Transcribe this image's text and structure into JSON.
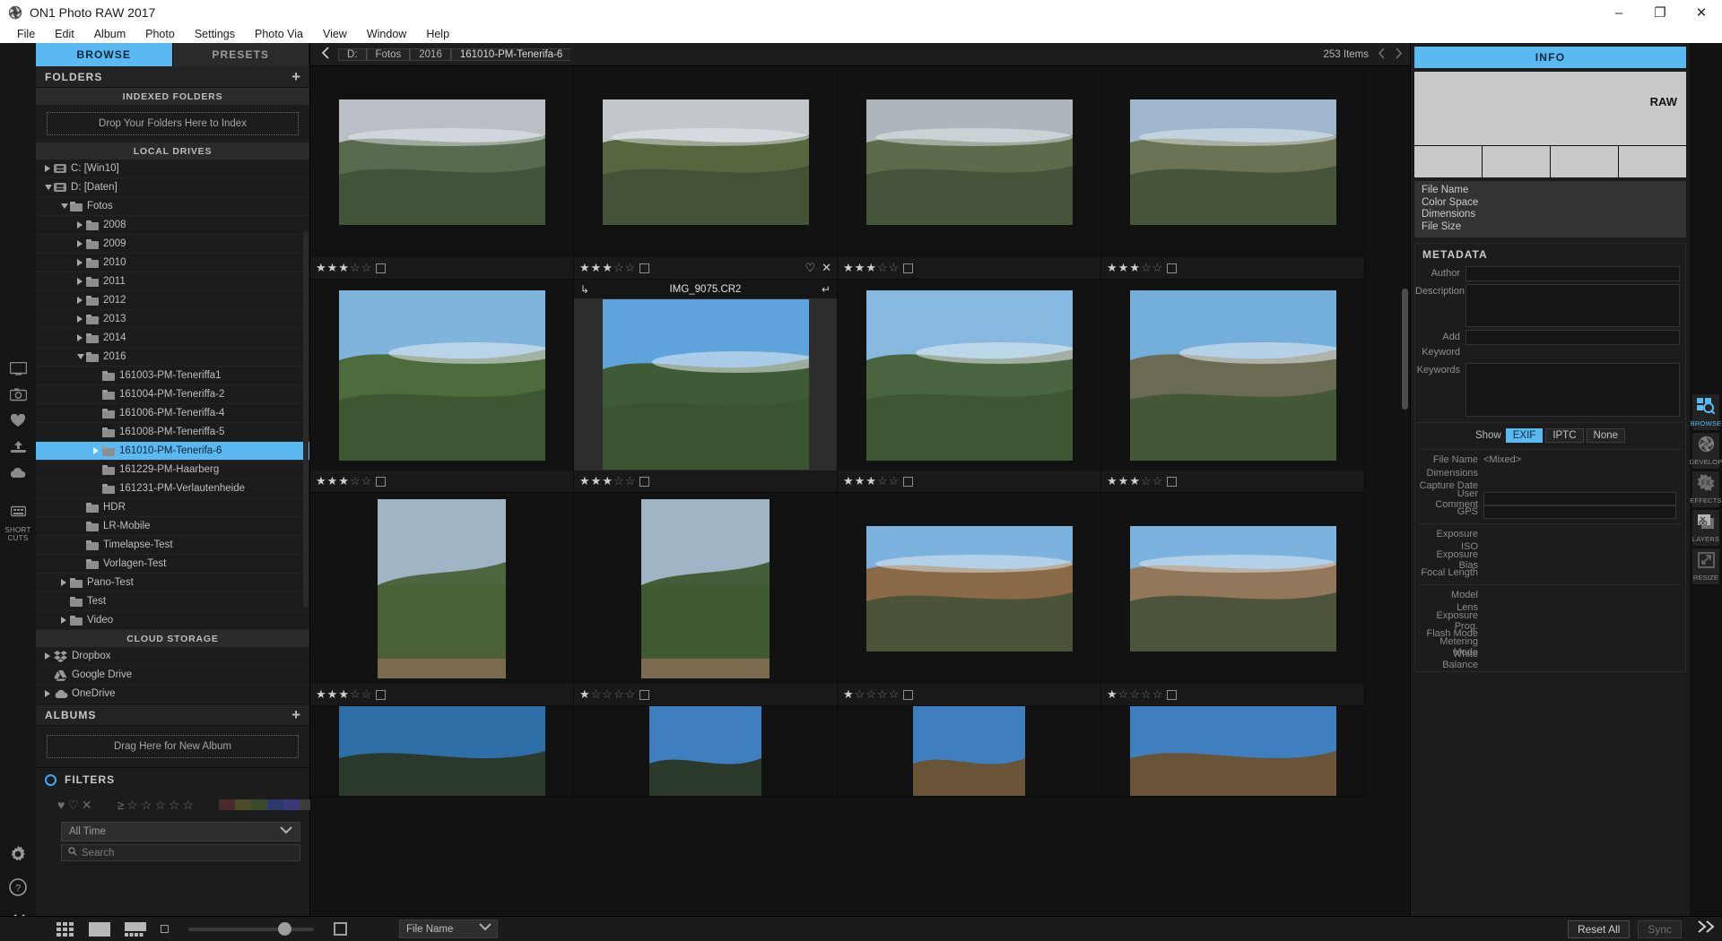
{
  "window": {
    "title": "ON1 Photo RAW 2017",
    "app_icon": "aperture-icon",
    "minimize": "–",
    "maximize": "❐",
    "close": "✕"
  },
  "menubar": [
    "File",
    "Edit",
    "Album",
    "Photo",
    "Settings",
    "Photo Via",
    "View",
    "Window",
    "Help"
  ],
  "left_panel": {
    "tabs": [
      {
        "label": "BROWSE",
        "active": true
      },
      {
        "label": "PRESETS",
        "active": false
      }
    ],
    "folders_title": "FOLDERS",
    "add_label": "+",
    "indexed_header": "INDEXED FOLDERS",
    "drop_label": "Drop Your Folders Here to Index",
    "local_header": "LOCAL DRIVES",
    "tree": [
      {
        "label": "C: [Win10]",
        "indent": 0,
        "arrow": "right",
        "icon": "drive-icon"
      },
      {
        "label": "D: [Daten]",
        "indent": 0,
        "arrow": "down",
        "icon": "drive-icon"
      },
      {
        "label": "Fotos",
        "indent": 1,
        "arrow": "down",
        "icon": "folder-icon"
      },
      {
        "label": "2008",
        "indent": 2,
        "arrow": "right",
        "icon": "folder-icon"
      },
      {
        "label": "2009",
        "indent": 2,
        "arrow": "right",
        "icon": "folder-icon"
      },
      {
        "label": "2010",
        "indent": 2,
        "arrow": "right",
        "icon": "folder-icon"
      },
      {
        "label": "2011",
        "indent": 2,
        "arrow": "right",
        "icon": "folder-icon"
      },
      {
        "label": "2012",
        "indent": 2,
        "arrow": "right",
        "icon": "folder-icon"
      },
      {
        "label": "2013",
        "indent": 2,
        "arrow": "right",
        "icon": "folder-icon"
      },
      {
        "label": "2014",
        "indent": 2,
        "arrow": "right",
        "icon": "folder-icon"
      },
      {
        "label": "2016",
        "indent": 2,
        "arrow": "down",
        "icon": "folder-icon"
      },
      {
        "label": "161003-PM-Teneriffa1",
        "indent": 3,
        "arrow": "none",
        "icon": "folder-icon"
      },
      {
        "label": "161004-PM-Teneriffa-2",
        "indent": 3,
        "arrow": "none",
        "icon": "folder-icon"
      },
      {
        "label": "161006-PM-Teneriffa-4",
        "indent": 3,
        "arrow": "none",
        "icon": "folder-icon"
      },
      {
        "label": "161008-PM-Teneriffa-5",
        "indent": 3,
        "arrow": "none",
        "icon": "folder-icon"
      },
      {
        "label": "161010-PM-Tenerifa-6",
        "indent": 3,
        "arrow": "right",
        "icon": "folder-icon",
        "selected": true
      },
      {
        "label": "161229-PM-Haarberg",
        "indent": 3,
        "arrow": "none",
        "icon": "folder-icon"
      },
      {
        "label": "161231-PM-Verlautenheide",
        "indent": 3,
        "arrow": "none",
        "icon": "folder-icon"
      },
      {
        "label": "HDR",
        "indent": 2,
        "arrow": "none",
        "icon": "folder-icon"
      },
      {
        "label": "LR-Mobile",
        "indent": 2,
        "arrow": "none",
        "icon": "folder-icon"
      },
      {
        "label": "Timelapse-Test",
        "indent": 2,
        "arrow": "none",
        "icon": "folder-icon"
      },
      {
        "label": "Vorlagen-Test",
        "indent": 2,
        "arrow": "none",
        "icon": "folder-icon"
      },
      {
        "label": "Pano-Test",
        "indent": 1,
        "arrow": "right",
        "icon": "folder-icon"
      },
      {
        "label": "Test",
        "indent": 1,
        "arrow": "none",
        "icon": "folder-icon"
      },
      {
        "label": "Video",
        "indent": 1,
        "arrow": "right",
        "icon": "folder-icon"
      }
    ],
    "cloud_header": "CLOUD STORAGE",
    "cloud": [
      {
        "label": "Dropbox",
        "arrow": "right",
        "icon": "dropbox-icon"
      },
      {
        "label": "Google Drive",
        "arrow": "none",
        "icon": "google-drive-icon"
      },
      {
        "label": "OneDrive",
        "arrow": "right",
        "icon": "onedrive-icon"
      }
    ],
    "albums_title": "ALBUMS",
    "albums_add": "+",
    "new_album_label": "Drag Here for New Album",
    "filters_title": "FILTERS",
    "filter_icons": [
      "heart-filled-icon",
      "heart-outline-icon",
      "reject-x-icon"
    ],
    "rating_prefix": "≥",
    "rating_stars": 5,
    "color_swatches": [
      "#4a2b2b",
      "#4a4a2b",
      "#3a4a2b",
      "#2b3a6a",
      "#3a3a7a",
      "#3d3d3d"
    ],
    "time_filter": "All Time",
    "search_placeholder": "Search"
  },
  "browse_bar": {
    "back_icon": "chevron-left-icon",
    "breadcrumb": [
      "D:",
      "Fotos",
      "2016",
      "161010-PM-Tenerifa-6"
    ],
    "item_count": "253 Items",
    "prev_icon": "chevron-left-icon",
    "next_icon": "chevron-right-icon"
  },
  "grid": {
    "cells": [
      {
        "rating": 3,
        "kind": "landscape-wide",
        "sky": "#b9bfc4",
        "land": "#5a6a4e",
        "selected": false,
        "filename": "",
        "flags": []
      },
      {
        "rating": 3,
        "kind": "landscape-wide",
        "sky": "#c2c7cb",
        "land": "#56663f",
        "selected": false,
        "filename": "",
        "flags": [
          "heart-outline-icon",
          "reject-x-icon"
        ]
      },
      {
        "rating": 3,
        "kind": "landscape-wide",
        "sky": "#aeb6bb",
        "land": "#5d6b4d",
        "selected": false,
        "filename": "",
        "flags": []
      },
      {
        "rating": 3,
        "kind": "landscape-wide",
        "sky": "#9fb6cc",
        "land": "#6a7455",
        "selected": false,
        "filename": "",
        "flags": []
      },
      {
        "rating": 3,
        "kind": "landscape-tall",
        "sky": "#7fb4dd",
        "land": "#4e6b3e",
        "selected": false,
        "filename": "",
        "flags": []
      },
      {
        "rating": 3,
        "kind": "landscape-tall",
        "sky": "#5ea3dc",
        "land": "#3f5b36",
        "selected": true,
        "filename": "IMG_9075.CR2",
        "flags": []
      },
      {
        "rating": 3,
        "kind": "landscape-tall",
        "sky": "#86b8e0",
        "land": "#4a6440",
        "selected": false,
        "filename": "",
        "flags": []
      },
      {
        "rating": 3,
        "kind": "landscape-tall",
        "sky": "#74aedb",
        "land": "#6b6a52",
        "selected": false,
        "filename": "",
        "flags": []
      },
      {
        "rating": 3,
        "kind": "portrait",
        "sky": "#9fb4c4",
        "land": "#4a6138",
        "selected": false,
        "filename": "",
        "flags": []
      },
      {
        "rating": 1,
        "kind": "portrait",
        "sky": "#9fb4c4",
        "land": "#3f5a33",
        "selected": false,
        "filename": "",
        "flags": []
      },
      {
        "rating": 1,
        "kind": "landscape-wide",
        "sky": "#7cb2de",
        "land": "#8a6a47",
        "selected": false,
        "filename": "",
        "flags": []
      },
      {
        "rating": 1,
        "kind": "landscape-wide",
        "sky": "#7cb2de",
        "land": "#93775a",
        "selected": false,
        "filename": "",
        "flags": []
      },
      {
        "rating": 0,
        "kind": "row-partial",
        "sky": "#2f6fa8",
        "land": "#2b3a2b",
        "selected": false,
        "filename": "",
        "flags": []
      },
      {
        "rating": 0,
        "kind": "row-partial-narrow",
        "sky": "#3f7fc0",
        "land": "#2b3a2b",
        "selected": false,
        "filename": "",
        "flags": []
      },
      {
        "rating": 0,
        "kind": "row-partial-narrow",
        "sky": "#3f7fc0",
        "land": "#6a5438",
        "selected": false,
        "filename": "",
        "flags": []
      },
      {
        "rating": 0,
        "kind": "row-partial",
        "sky": "#3f7fc0",
        "land": "#6a5438",
        "selected": false,
        "filename": "",
        "flags": []
      }
    ]
  },
  "right_panel": {
    "info_title": "INFO",
    "raw_badge": "RAW",
    "info_fields": [
      "File Name",
      "Color Space",
      "Dimensions",
      "File Size"
    ],
    "metadata_title": "METADATA",
    "metadata_fields": [
      {
        "label": "Author",
        "type": "input"
      },
      {
        "label": "Description",
        "type": "textarea"
      },
      {
        "label": "Add Keyword",
        "type": "input"
      },
      {
        "label": "Keywords",
        "type": "textarea2"
      }
    ],
    "show_label": "Show",
    "show_options": [
      {
        "label": "EXIF",
        "active": true
      },
      {
        "label": "IPTC",
        "active": false
      },
      {
        "label": "None",
        "active": false
      }
    ],
    "exif_groups": [
      [
        {
          "label": "File Name",
          "value": "<Mixed>",
          "field": false
        },
        {
          "label": "Dimensions",
          "value": "",
          "field": false
        },
        {
          "label": "Capture Date",
          "value": "",
          "field": false
        },
        {
          "label": "User Comment",
          "value": "",
          "field": true
        },
        {
          "label": "GPS",
          "value": "",
          "field": true
        }
      ],
      [
        {
          "label": "Exposure",
          "value": "",
          "field": false
        },
        {
          "label": "ISO",
          "value": "",
          "field": false
        },
        {
          "label": "Exposure Bias",
          "value": "",
          "field": false
        },
        {
          "label": "Focal Length",
          "value": "",
          "field": false
        }
      ],
      [
        {
          "label": "Model",
          "value": "",
          "field": false
        },
        {
          "label": "Lens",
          "value": "",
          "field": false
        },
        {
          "label": "Exposure Prog.",
          "value": "",
          "field": false
        },
        {
          "label": "Flash Mode",
          "value": "",
          "field": false
        },
        {
          "label": "Metering Mode",
          "value": "",
          "field": false
        },
        {
          "label": "White Balance",
          "value": "",
          "field": false
        }
      ]
    ]
  },
  "right_rail": [
    {
      "label": "BROWSE",
      "icon": "browse-icon",
      "active": true
    },
    {
      "label": "DEVELOP",
      "icon": "aperture-icon",
      "active": false
    },
    {
      "label": "EFFECTS",
      "icon": "fx-icon",
      "active": false
    },
    {
      "label": "LAYERS",
      "icon": "layers-icon",
      "active": false
    },
    {
      "label": "RESIZE",
      "icon": "resize-icon",
      "active": false
    }
  ],
  "left_rail": [
    {
      "icon": "monitor-icon"
    },
    {
      "icon": "camera-icon"
    },
    {
      "icon": "heart-icon"
    },
    {
      "icon": "export-icon"
    },
    {
      "icon": "cloud-icon"
    },
    {
      "icon": "shortcuts-icon",
      "label": "SHORT CUTS"
    }
  ],
  "left_rail_bottom": [
    {
      "icon": "gear-icon"
    },
    {
      "icon": "help-icon"
    },
    {
      "icon": "collapse-left-icon"
    }
  ],
  "bottom_bar": {
    "view_modes": [
      "grid-view-icon",
      "single-view-icon",
      "filmstrip-view-icon"
    ],
    "small_square_icon": "small-thumb-icon",
    "large_square_icon": "large-thumb-icon",
    "zoom_value": 72,
    "sort_label": "File Name",
    "sort_chevron": "chevron-down-icon",
    "reset_all": "Reset All",
    "sync": "Sync",
    "expand_icon": "chevron-double-right-icon"
  }
}
